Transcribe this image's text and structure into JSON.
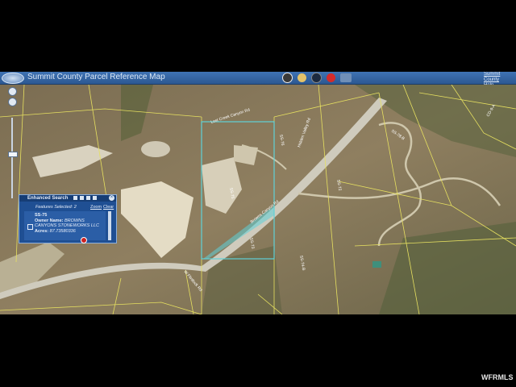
{
  "app": {
    "title": "Summit County Parcel Reference Map"
  },
  "header_links": {
    "county": "Summit County",
    "help": "Help"
  },
  "colors": {
    "titlebar": "#2f62a3",
    "parcel_line": "#e6e060",
    "selection": "#5fd2d8",
    "panel": "#1f4f93"
  },
  "toolbar_icons": [
    "home-icon",
    "info-icon",
    "layers-icon",
    "stop-icon",
    "measure-icon"
  ],
  "search_panel": {
    "title": "Enhanced Search",
    "features_selected": "Features Selected: 2",
    "zoom_label": "Zoom",
    "clear_label": "Clear",
    "result": {
      "parcel_id": "SS-75",
      "owner_label": "Owner Name:",
      "owner_value": "BROWNS CANYONS STONEWORKS LLC",
      "acres_label": "Acres:",
      "acres_value": "87.73580336"
    }
  },
  "map_labels": {
    "road1": "Browns Canyon Rd",
    "road2": "Lost Creek Canyon Rd",
    "road3": "Hidden Valley Rd",
    "road4": "W Flintlock Rd",
    "parcel1": "SS-75",
    "parcel2": "SS-76",
    "parcel3": "SS-74-B",
    "parcel4": "SS-78-B",
    "parcel5": "SS-72",
    "parcel6": "CD-9-A",
    "parcel7": "SS-73"
  },
  "watermark": "WFRMLS"
}
